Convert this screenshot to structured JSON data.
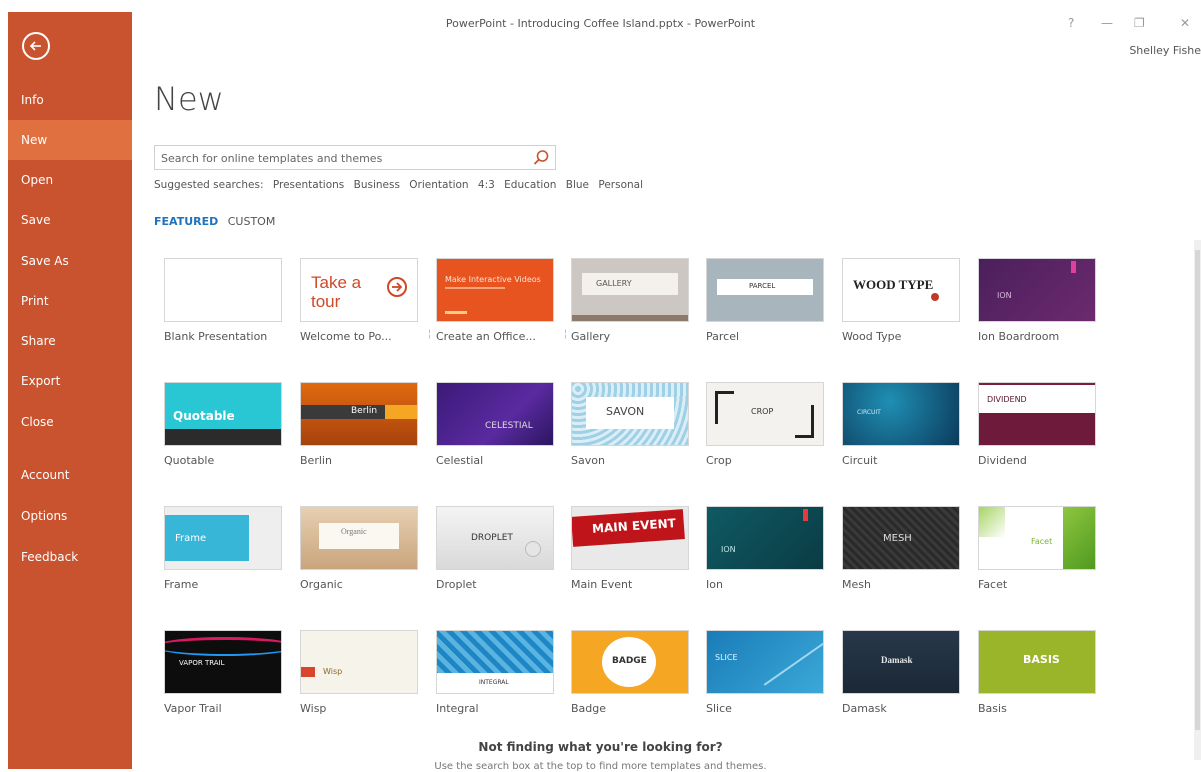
{
  "window": {
    "title": "PowerPoint - Introducing Coffee Island.pptx - PowerPoint",
    "help": "?",
    "minimize": "—",
    "restore": "❐",
    "close": "✕",
    "user": "Shelley Fishe"
  },
  "sidebar": {
    "back_icon": "back-arrow-icon",
    "items": [
      {
        "label": "Info"
      },
      {
        "label": "New"
      },
      {
        "label": "Open"
      },
      {
        "label": "Save"
      },
      {
        "label": "Save As"
      },
      {
        "label": "Print"
      },
      {
        "label": "Share"
      },
      {
        "label": "Export"
      },
      {
        "label": "Close"
      },
      {
        "label": "Account"
      },
      {
        "label": "Options"
      },
      {
        "label": "Feedback"
      }
    ],
    "active": "New",
    "color": "#c9532f",
    "active_color": "#e0703f"
  },
  "main": {
    "title": "New",
    "search": {
      "placeholder": "Search for online templates and themes",
      "icon": "search-icon"
    },
    "suggested": {
      "label": "Suggested searches:",
      "items": [
        "Presentations",
        "Business",
        "Orientation",
        "4:3",
        "Education",
        "Blue",
        "Personal"
      ]
    },
    "tabs": [
      {
        "label": "FEATURED"
      },
      {
        "label": "CUSTOM"
      }
    ],
    "templates": [
      {
        "name": "Blank Presentation",
        "thumb_text": ""
      },
      {
        "name": "Welcome to Po...",
        "thumb_text": "Take a tour"
      },
      {
        "name": "Create an Office...",
        "thumb_text": "Make Interactive Videos"
      },
      {
        "name": "Gallery",
        "thumb_text": "GALLERY"
      },
      {
        "name": "Parcel",
        "thumb_text": "PARCEL"
      },
      {
        "name": "Wood Type",
        "thumb_text": "WOOD TYPE"
      },
      {
        "name": "Ion Boardroom",
        "thumb_text": "ION"
      },
      {
        "name": "Quotable",
        "thumb_text": "Quotable"
      },
      {
        "name": "Berlin",
        "thumb_text": "Berlin"
      },
      {
        "name": "Celestial",
        "thumb_text": "CELESTIAL"
      },
      {
        "name": "Savon",
        "thumb_text": "SAVON"
      },
      {
        "name": "Crop",
        "thumb_text": "CROP"
      },
      {
        "name": "Circuit",
        "thumb_text": "CIRCUIT"
      },
      {
        "name": "Dividend",
        "thumb_text": "DIVIDEND"
      },
      {
        "name": "Frame",
        "thumb_text": "Frame"
      },
      {
        "name": "Organic",
        "thumb_text": "Organic"
      },
      {
        "name": "Droplet",
        "thumb_text": "DROPLET"
      },
      {
        "name": "Main Event",
        "thumb_text": "MAIN EVENT"
      },
      {
        "name": "Ion",
        "thumb_text": "ION"
      },
      {
        "name": "Mesh",
        "thumb_text": "MESH"
      },
      {
        "name": "Facet",
        "thumb_text": "Facet"
      },
      {
        "name": "Vapor Trail",
        "thumb_text": "VAPOR TRAIL"
      },
      {
        "name": "Wisp",
        "thumb_text": "Wisp"
      },
      {
        "name": "Integral",
        "thumb_text": "INTEGRAL"
      },
      {
        "name": "Badge",
        "thumb_text": "BADGE"
      },
      {
        "name": "Slice",
        "thumb_text": "SLICE"
      },
      {
        "name": "Damask",
        "thumb_text": "Damask"
      },
      {
        "name": "Basis",
        "thumb_text": "BASIS"
      }
    ],
    "footer": {
      "title": "Not finding what you're looking for?",
      "subtitle": "Use the search box at the top to find more templates and themes."
    }
  }
}
